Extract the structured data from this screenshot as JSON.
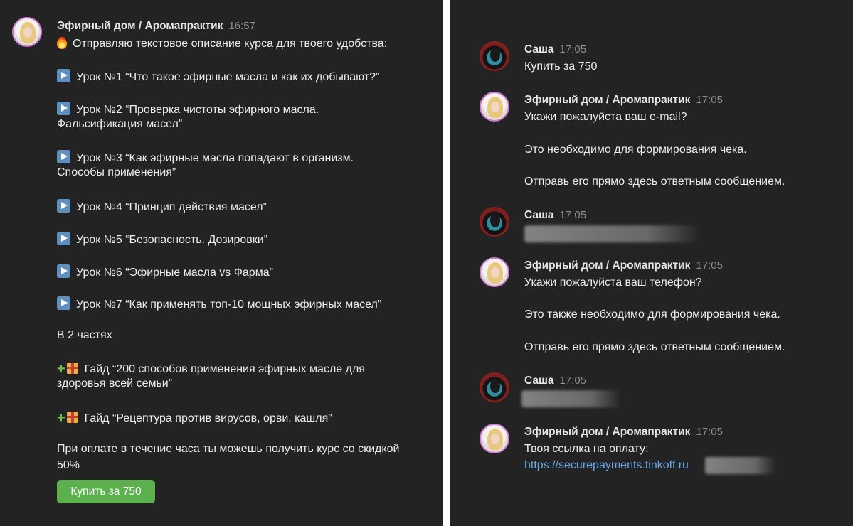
{
  "left": {
    "author": "Эфирный дом / Аромапрактик",
    "time": "16:57",
    "intro": "Отправляю текстовое описание курса для твоего удобства:",
    "lessons": [
      {
        "l1": "Урок №1 “Что такое эфирные масла и как их добывают?”",
        "l2": ""
      },
      {
        "l1": "Урок №2 “Проверка чистоты эфирного масла.",
        "l2": "Фальсификация масел”"
      },
      {
        "l1": "Урок №3 “Как эфирные масла попадают в организм.",
        "l2": "Способы применения”"
      },
      {
        "l1": "Урок №4 “Принцип действия масел”",
        "l2": ""
      },
      {
        "l1": "Урок №5 “Безопасность. Дозировки”",
        "l2": ""
      },
      {
        "l1": "Урок №6 “Эфирные масла vs Фарма”",
        "l2": ""
      },
      {
        "l1": "Урок №7 “Как применять топ-10 мощных эфирных масел”",
        "l2": ""
      }
    ],
    "parts": "В 2 частях",
    "guide1_l1": "Гайд “200 способов применения эфирных масле для",
    "guide1_l2": "здоровья всей семьи”",
    "guide2": "Гайд “Рецептура против вирусов, орви, кашля”",
    "offer_l1": "При оплате в течение часа ты можешь получить курс со скидкой",
    "offer_l2": "50%",
    "button": "Купить за 750"
  },
  "right": {
    "messages": [
      {
        "author": "Саша",
        "time": "17:05",
        "lines": [
          "Купить за 750"
        ]
      },
      {
        "author": "Эфирный дом / Аромапрактик",
        "time": "17:05",
        "lines": [
          "Укажи пожалуйста ваш e-mail?",
          "Это необходимо для формирования чека.",
          "Отправь его прямо здесь ответным сообщением."
        ]
      },
      {
        "author": "Саша",
        "time": "17:05",
        "lines": []
      },
      {
        "author": "Эфирный дом / Аромапрактик",
        "time": "17:05",
        "lines": [
          "Укажи пожалуйста ваш телефон?",
          "Это также необходимо для формирования чека.",
          "Отправь его прямо здесь ответным сообщением."
        ]
      },
      {
        "author": "Саша",
        "time": "17:05",
        "lines": []
      },
      {
        "author": "Эфирный дом / Аромапрактик",
        "time": "17:05",
        "lines": [
          "Твоя ссылка на оплату:"
        ],
        "link": "https://securepayments.tinkoff.ru"
      }
    ]
  },
  "icons": {
    "fire": "fire-icon",
    "play": "play-button-icon",
    "plus": "plus-icon",
    "gift": "gift-icon"
  },
  "colors": {
    "background": "#232323",
    "button": "#5cb04d",
    "link": "#6aa7e8",
    "avatar_ring": "#c87bd0"
  }
}
